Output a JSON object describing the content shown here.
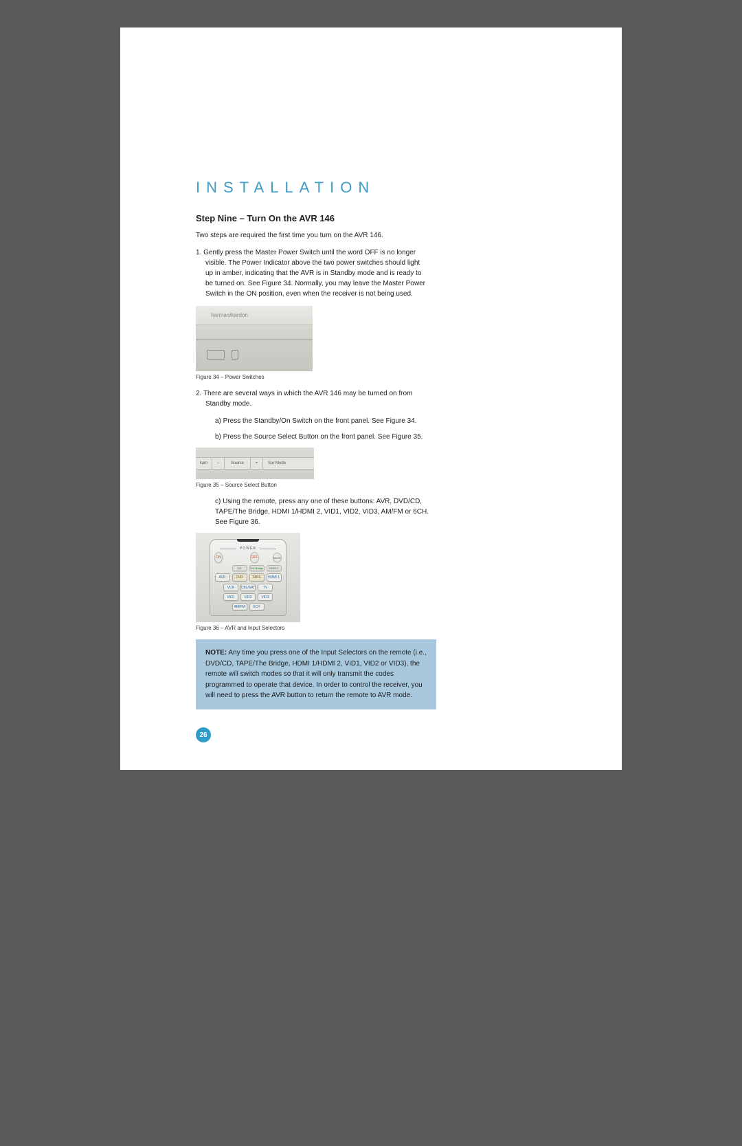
{
  "section_title": "INSTALLATION",
  "step_heading": "Step Nine – Turn On the AVR 146",
  "intro": "Two steps are required the first time you turn on the AVR 146.",
  "item1": "1. Gently press the Master Power Switch until the word OFF is no longer visible. The Power Indicator above the two power switches should light up in amber, indicating that the AVR is in Standby mode and is ready to be turned on. See Figure 34. Normally, you may leave the Master Power Switch in the ON position, even when the receiver is not being used.",
  "fig34": {
    "brand": "harman/kardon",
    "caption": "Figure 34 – Power Switches"
  },
  "item2": "2. There are several ways in which the AVR 146 may be turned on from Standby mode.",
  "item2a": "a) Press the Standby/On Switch on the front panel. See Figure 34.",
  "item2b": "b) Press the Source Select Button on the front panel. See Figure 35.",
  "fig35": {
    "cells": [
      "kam",
      "–",
      "Source",
      "+",
      "Sur Mode"
    ],
    "caption": "Figure 35 – Source Select Button"
  },
  "item2c": "c) Using the remote, press any one of these buttons: AVR, DVD/CD, TAPE/The Bridge, HDMI 1/HDMI 2, VID1, VID2, VID3, AM/FM or 6CH. See Figure 36.",
  "fig36": {
    "power_label": "POWER",
    "buttons": {
      "on": "ON",
      "off": "OFF",
      "mute": "MUTE",
      "row2": [
        "CD",
        "The Bridge",
        "HDMI 2"
      ],
      "row3": [
        "AVR",
        "DVD",
        "TAPE",
        "HDMI 1"
      ],
      "row4": [
        "VCR",
        "CBL/SAT",
        "TV"
      ],
      "row5": [
        "VID1",
        "VID2",
        "VID3"
      ],
      "row6": [
        "AM/FM",
        "6CH"
      ]
    },
    "caption": "Figure 36 – AVR and Input Selectors"
  },
  "note": {
    "label": "NOTE:",
    "text": " Any time you press one of the Input Selectors on the remote (i.e., DVD/CD, TAPE/The Bridge, HDMI 1/HDMI 2, VID1, VID2 or VID3), the remote will switch modes so that it will only transmit the codes programmed to operate that device. In order to control the receiver, you will need to press the AVR button to return the remote to AVR mode."
  },
  "page_number": "26"
}
